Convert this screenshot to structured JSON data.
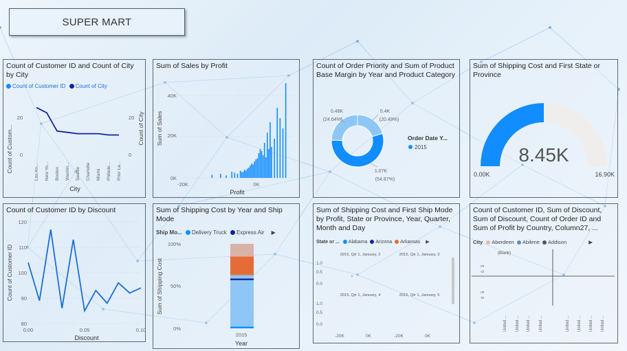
{
  "app": {
    "title": "SUPER MART"
  },
  "colors": {
    "bright": "#118dff",
    "navy": "#12239e",
    "orange": "#e66c37",
    "pink": "#d9b3a8",
    "light": "#8ec7f5",
    "gauge_rest": "#efeeed",
    "line": "#1a6fd6"
  },
  "panels": {
    "p1": {
      "title": "Count of Customer ID and Count of City by City",
      "legend": [
        "Count of Customer ID",
        "Count of City"
      ],
      "ylabel_left": "Count of Custom...",
      "ylabel_right": "Count of City",
      "xlabel": "City",
      "left_ticks": [
        "20",
        "0"
      ],
      "right_ticks": [
        "20",
        "0"
      ]
    },
    "p2": {
      "title": "Sum of Sales by Profit",
      "ylabel": "Sum of Sales",
      "xlabel": "Profit",
      "y_ticks": [
        "40K",
        "20K",
        "0K"
      ],
      "x_ticks": [
        "-20K",
        "0K"
      ]
    },
    "p3": {
      "title": "Count of Order Priority and Sum of Product Base Margin by Year and Product Category",
      "legend_title": "Order Date Y...",
      "legend_item": "2015",
      "labels": {
        "a1": "0.48K",
        "a2": "(24.64%)",
        "b1": "0.4K",
        "b2": "(20.49%)",
        "c1": "1.07K",
        "c2": "(54.87%)"
      }
    },
    "p4": {
      "title": "Sum of Shipping Cost and First State or Province",
      "value": "8.45K",
      "min": "0.00K",
      "max": "16.90K"
    },
    "p5": {
      "title": "Count of Customer ID by Discount",
      "ylabel": "Count of Customer ID",
      "xlabel": "Discount",
      "y_ticks": [
        "120",
        "110",
        "100",
        "90",
        "80"
      ],
      "x_ticks": [
        "0.00",
        "0.05",
        "0.10"
      ]
    },
    "p6": {
      "title": "Sum of Shipping Cost by Year and Ship Mode",
      "legend_label": "Ship Mo...",
      "legend": [
        "Delivery Truck",
        "Express Air"
      ],
      "ylabel": "Sum of Shipping Cost",
      "xlabel": "Year",
      "y_ticks": [
        "100%",
        "50%",
        "0%"
      ],
      "x_tick": "2015"
    },
    "p7": {
      "title": "Sum of Shipping Cost and First Ship Mode by Profit, State or Province, Year, Quarter, Month and Day",
      "legend_label": "State or ...",
      "legend": [
        "Alabama",
        "Arizona",
        "Arkansas"
      ],
      "facets": [
        "2015, Qtr 1, January, 2",
        "2015, Qtr 1, January, 3",
        "2015, Qtr 1, January, 4",
        "2015, Qtr 1, January, 5"
      ],
      "y_ticks": [
        "1.0",
        "0.5",
        "0.0"
      ],
      "x_ticks": [
        "-20K",
        "0K",
        "-20K",
        "0K"
      ]
    },
    "p8": {
      "title": "Count of Customer ID, Sum of Discount, Sum of Discount, Count of Order ID and Sum of Profit by Country, Column27, ...",
      "legend_label": "City",
      "legend": [
        "Aberdeen",
        "Abilene",
        "Addison"
      ],
      "blank": "(Blank)",
      "y_tick_a": "5",
      "y_tick_b": "0",
      "x_tick": "United ..."
    }
  },
  "chart_data": [
    {
      "type": "line",
      "title": "Count of Customer ID and Count of City by City",
      "xlabel": "City",
      "categories": [
        "Los An...",
        "New Yo...",
        "Boston",
        "Washin...",
        "Seattle",
        "Charlotte",
        "Miami",
        "Philade...",
        "Prior La..."
      ],
      "series": [
        {
          "name": "Count of Customer ID",
          "values": [
            36,
            32,
            18,
            17,
            16,
            16,
            16,
            15,
            15
          ]
        },
        {
          "name": "Count of City",
          "values": [
            null,
            null,
            null,
            null,
            null,
            null,
            null,
            null,
            null
          ]
        }
      ],
      "ylim": [
        0,
        40
      ]
    },
    {
      "type": "bar",
      "title": "Sum of Sales by Profit",
      "xlabel": "Profit",
      "ylabel": "Sum of Sales",
      "x": [
        -14000,
        -11000,
        -9000,
        -7000,
        -6000,
        -5000,
        -4000,
        -3500,
        -3000,
        -2500,
        -2000,
        -1500,
        -1000,
        -500,
        0,
        500,
        1000,
        1500,
        2000,
        2500,
        3000,
        3500,
        4000,
        4500,
        5000,
        5500,
        6000,
        6500,
        7000,
        8000,
        9000,
        10000,
        11000,
        12000
      ],
      "values": [
        1500,
        2000,
        1200,
        3000,
        2500,
        2000,
        3500,
        2800,
        3000,
        4000,
        3500,
        4500,
        5000,
        6000,
        7000,
        6500,
        8000,
        9000,
        9500,
        12000,
        14000,
        13000,
        11000,
        17000,
        10000,
        22000,
        14000,
        27000,
        15000,
        19000,
        34000,
        29000,
        24000,
        46000
      ],
      "xlim": [
        -25000,
        15000
      ],
      "ylim": [
        0,
        46000
      ]
    },
    {
      "type": "pie",
      "title": "Count of Order Priority and Sum of Product Base Margin by Year and Product Category",
      "categories": [
        "slice 1",
        "slice 2",
        "slice 3"
      ],
      "values": [
        480,
        400,
        1070
      ],
      "percent": [
        24.64,
        20.49,
        54.87
      ],
      "legend": [
        "2015"
      ]
    },
    {
      "type": "gauge",
      "title": "Sum of Shipping Cost and First State or Province",
      "value": 8450,
      "min": 0,
      "max": 16900
    },
    {
      "type": "line",
      "title": "Count of Customer ID by Discount",
      "xlabel": "Discount",
      "ylabel": "Count of Customer ID",
      "x": [
        0.0,
        0.01,
        0.02,
        0.03,
        0.04,
        0.05,
        0.06,
        0.07,
        0.08,
        0.09,
        0.1
      ],
      "values": [
        104,
        89,
        117,
        86,
        113,
        85,
        93,
        88,
        96,
        92,
        94
      ],
      "xlim": [
        0,
        0.1
      ],
      "ylim": [
        80,
        120
      ]
    },
    {
      "type": "bar",
      "title": "Sum of Shipping Cost by Year and Ship Mode",
      "xlabel": "Year",
      "ylabel": "Sum of Shipping Cost",
      "categories": [
        "2015"
      ],
      "series": [
        {
          "name": "segment 1",
          "values": [
            0.02
          ]
        },
        {
          "name": "segment 2",
          "values": [
            0.55
          ]
        },
        {
          "name": "segment 3",
          "values": [
            0.02
          ]
        },
        {
          "name": "segment 4",
          "values": [
            0.04
          ]
        },
        {
          "name": "segment 5",
          "values": [
            0.22
          ]
        },
        {
          "name": "segment 6",
          "values": [
            0.15
          ]
        }
      ],
      "ylim": [
        0,
        1
      ]
    }
  ]
}
